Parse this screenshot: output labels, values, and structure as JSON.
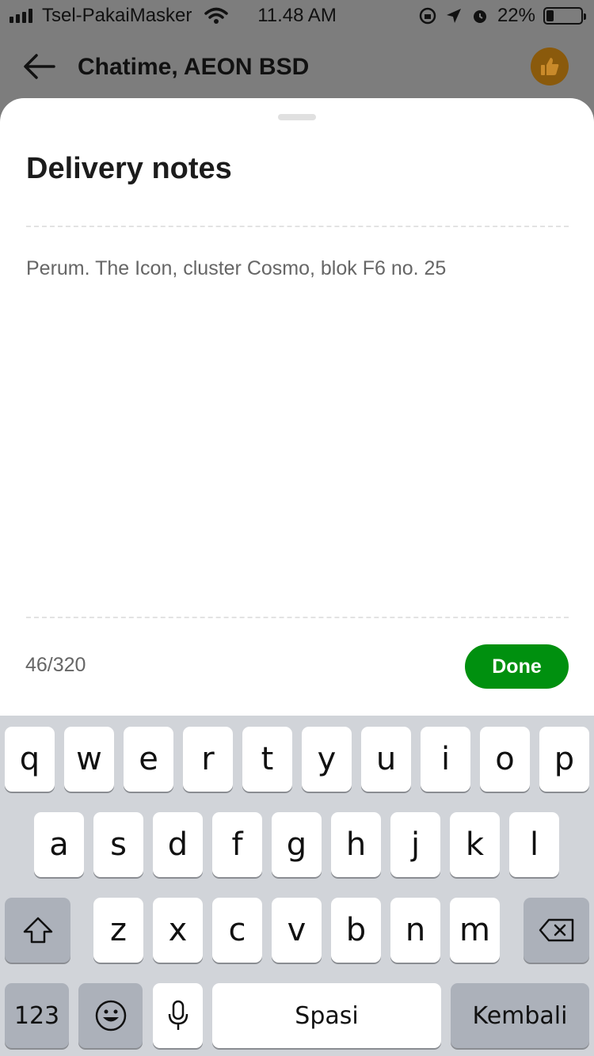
{
  "status_bar": {
    "carrier": "Tsel-PakaiMasker",
    "time": "11.48 AM",
    "battery_percent": "22%",
    "battery_level": 0.22
  },
  "app_header": {
    "title": "Chatime, AEON BSD",
    "back_icon": "arrow-left-icon",
    "badge_icon": "thumbs-up-icon"
  },
  "sheet": {
    "title": "Delivery notes",
    "notes_value": "Perum. The Icon, cluster Cosmo, blok F6 no. 25",
    "char_count": "46/320",
    "done_label": "Done",
    "accent_color": "#00900f"
  },
  "keyboard": {
    "row1": [
      "q",
      "w",
      "e",
      "r",
      "t",
      "y",
      "u",
      "i",
      "o",
      "p"
    ],
    "row2": [
      "a",
      "s",
      "d",
      "f",
      "g",
      "h",
      "j",
      "k",
      "l"
    ],
    "row3": [
      "z",
      "x",
      "c",
      "v",
      "b",
      "n",
      "m"
    ],
    "numbers_label": "123",
    "space_label": "Spasi",
    "return_label": "Kembali"
  }
}
